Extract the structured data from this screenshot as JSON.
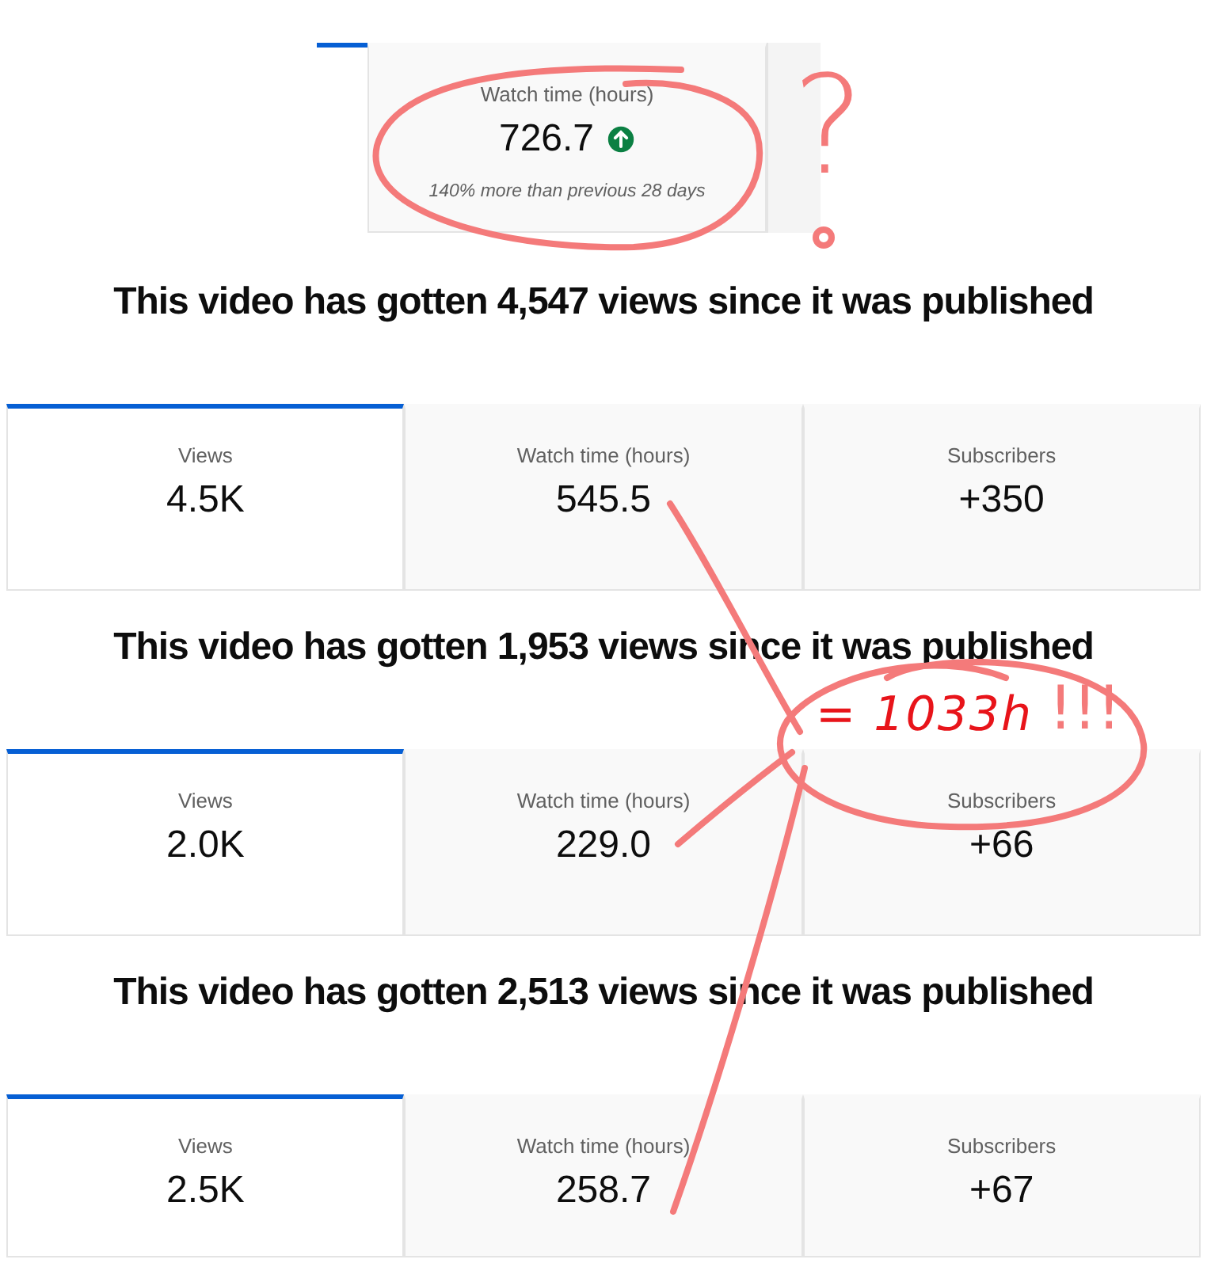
{
  "top_snippet": {
    "tabs": [
      {
        "selected": true
      },
      {
        "label": "Watch time (hours)",
        "value": "726.7",
        "rising": true,
        "note": "140% more than previous 28 days",
        "selected": false
      },
      {
        "selected": false
      }
    ]
  },
  "sections": [
    {
      "heading": "This video has gotten 4,547 views since it was published",
      "tabs": [
        {
          "label": "Views",
          "value": "4.5K",
          "selected": true
        },
        {
          "label": "Watch time (hours)",
          "value": "545.5",
          "selected": false
        },
        {
          "label": "Subscribers",
          "value": "+350",
          "selected": false
        }
      ]
    },
    {
      "heading": "This video has gotten 1,953 views since it was published",
      "tabs": [
        {
          "label": "Views",
          "value": "2.0K",
          "selected": true
        },
        {
          "label": "Watch time (hours)",
          "value": "229.0",
          "selected": false
        },
        {
          "label": "Subscribers",
          "value": "+66",
          "selected": false
        }
      ]
    },
    {
      "heading": "This video has gotten 2,513 views since it was published",
      "tabs": [
        {
          "label": "Views",
          "value": "2.5K",
          "selected": true
        },
        {
          "label": "Watch time (hours)",
          "value": "258.7",
          "selected": false
        },
        {
          "label": "Subscribers",
          "value": "+67",
          "selected": false
        }
      ]
    }
  ],
  "annotations": {
    "question": "?",
    "total": "= 1033h",
    "exclaim": "!!!"
  }
}
